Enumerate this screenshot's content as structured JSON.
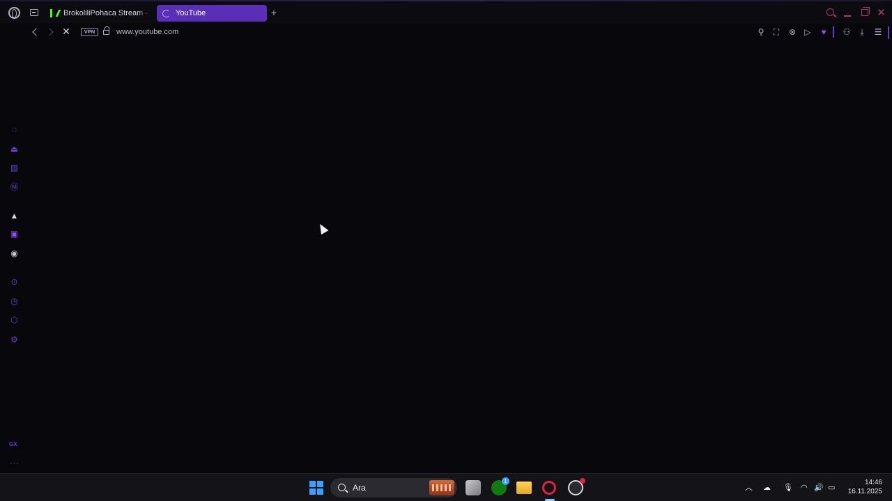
{
  "browser": {
    "tabs": [
      {
        "title": "BrokoliliPohaca Stream - \\",
        "active": false,
        "favicon": "kick-icon"
      },
      {
        "title": "YouTube",
        "active": true,
        "favicon": "loading-spinner-icon"
      }
    ],
    "address": {
      "vpn_label": "VPN",
      "url": "www.youtube.com"
    },
    "accent_color": "#5a2fb8"
  },
  "sidebar": {
    "items": [
      {
        "icon": "aria-icon"
      },
      {
        "icon": "gx-corner-icon"
      },
      {
        "icon": "gx-cleaner-icon"
      },
      {
        "icon": "m-icon"
      },
      {
        "icon": "arc-icon"
      },
      {
        "icon": "twitch-icon"
      },
      {
        "icon": "discord-icon"
      },
      {
        "icon": "player-icon"
      },
      {
        "icon": "history-icon"
      },
      {
        "icon": "extensions-icon"
      },
      {
        "icon": "settings-icon"
      }
    ],
    "gx_label": "GX",
    "more_label": "···"
  },
  "taskbar": {
    "search_placeholder": "Ara",
    "time": "14:46",
    "date": "16.11.2025",
    "xbox_badge": "1"
  }
}
